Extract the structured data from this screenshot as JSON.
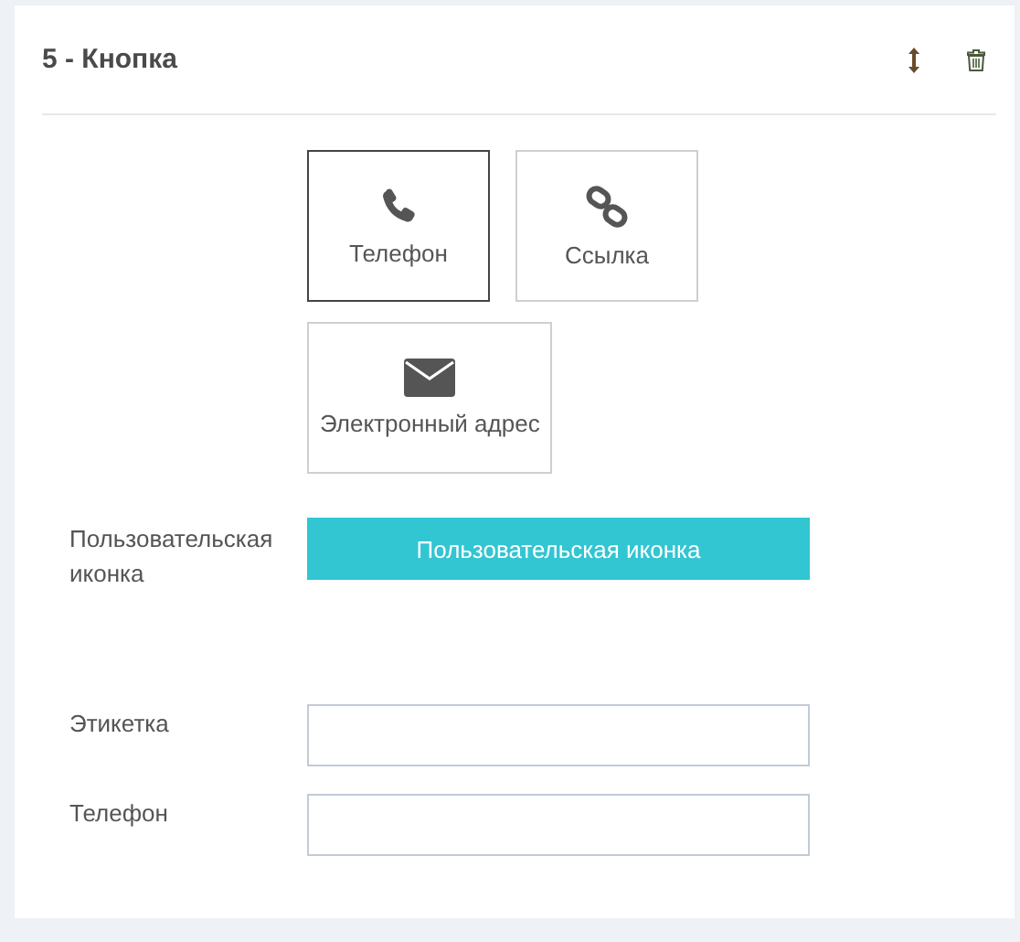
{
  "panel": {
    "title": "5 - Кнопка"
  },
  "options": [
    {
      "label": "Телефон",
      "kind": "phone",
      "selected": true
    },
    {
      "label": "Ссылка",
      "kind": "link",
      "selected": false
    },
    {
      "label": "Электронный адрес",
      "kind": "email",
      "selected": false
    }
  ],
  "custom_icon": {
    "label": "Пользовательская иконка",
    "button": "Пользовательская иконка"
  },
  "fields": [
    {
      "label": "Этикетка"
    },
    {
      "label": "Телефон"
    }
  ]
}
